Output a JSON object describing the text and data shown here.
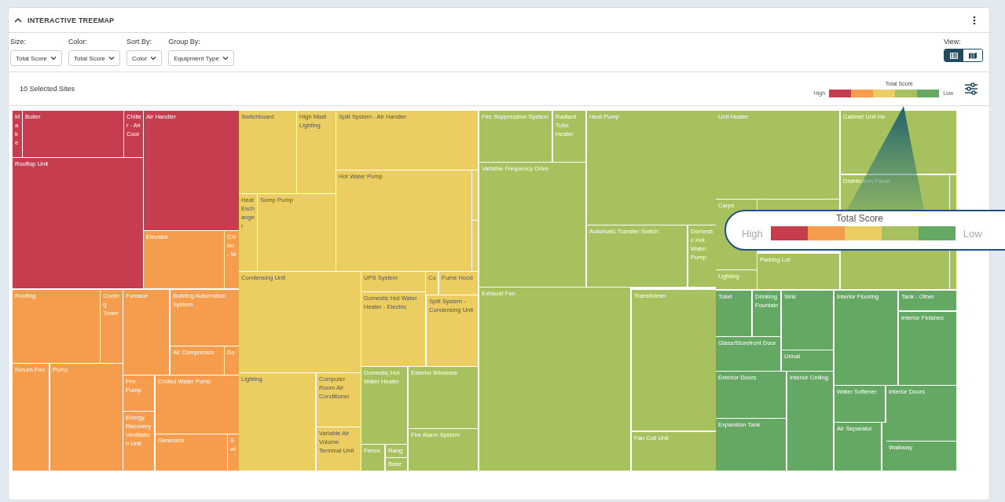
{
  "panel": {
    "title": "INTERACTIVE TREEMAP",
    "expanded": true
  },
  "filters": [
    {
      "label": "Size:",
      "value": "Total Score"
    },
    {
      "label": "Color:",
      "value": "Total Score"
    },
    {
      "label": "Sort By:",
      "value": "Color"
    },
    {
      "label": "Group By:",
      "value": "Equipment Type"
    }
  ],
  "view": {
    "label": "View:",
    "options": [
      {
        "kind": "table",
        "selected": true
      },
      {
        "kind": "map",
        "selected": false
      }
    ]
  },
  "selection_summary": "10 Selected Sites",
  "legend": {
    "title": "Total Score",
    "high": "High",
    "low": "Low",
    "swatches": [
      {
        "color": "#c63d50"
      },
      {
        "color": "#f59d4d"
      },
      {
        "color": "#ebcd62"
      },
      {
        "color": "#a6c15e"
      },
      {
        "color": "#64a864"
      }
    ]
  },
  "treemap": {
    "tiles": [
      {
        "label": "Make",
        "color": "#c63d50"
      },
      {
        "label": "Boiler",
        "color": "#c63d50"
      },
      {
        "label": "Chiller - Air Cool",
        "color": "#c63d50"
      },
      {
        "label": "Rooftop Unit",
        "color": "#c63d50"
      },
      {
        "label": "Air Handler",
        "color": "#c63d50"
      },
      {
        "label": "Elevator",
        "color": "#f59d4d"
      },
      {
        "label": "Chiller - W",
        "color": "#f59d4d"
      },
      {
        "label": "Roofing",
        "color": "#f59d4d"
      },
      {
        "label": "Cooling Tower",
        "color": "#f59d4d"
      },
      {
        "label": "Furnace",
        "color": "#f59d4d"
      },
      {
        "label": "Building Automation System",
        "color": "#f59d4d"
      },
      {
        "label": "Air Compressor",
        "color": "#f59d4d"
      },
      {
        "label": "Do",
        "color": "#f59d4d"
      },
      {
        "label": "Return Fan",
        "color": "#f59d4d"
      },
      {
        "label": "Pump",
        "color": "#f59d4d"
      },
      {
        "label": "Fire Pump",
        "color": "#f59d4d"
      },
      {
        "label": "Energy Recovery Ventilation Unit",
        "color": "#f59d4d"
      },
      {
        "label": "Chilled Water Pump",
        "color": "#f59d4d"
      },
      {
        "label": "Generator",
        "color": "#f59d4d"
      },
      {
        "label": "Swi",
        "color": "#f59d4d"
      },
      {
        "label": "Switchboard",
        "color": "#ebcd62"
      },
      {
        "label": "High Mast Lighting",
        "color": "#ebcd62"
      },
      {
        "label": "Split System - Air Handler",
        "color": "#ebcd62"
      },
      {
        "label": "Heat Exchanger",
        "color": "#ebcd62"
      },
      {
        "label": "Sump Pump",
        "color": "#ebcd62"
      },
      {
        "label": "Hot Water Pump",
        "color": "#ebcd62"
      },
      {
        "color": "#ebcd62"
      },
      {
        "color": "#ebcd62"
      },
      {
        "label": "Condensing Unit",
        "color": "#ebcd62"
      },
      {
        "label": "UPS System",
        "color": "#ebcd62"
      },
      {
        "label": "Co",
        "color": "#ebcd62"
      },
      {
        "label": "Fume Hood",
        "color": "#ebcd62"
      },
      {
        "label": "Domestic Hot Water Heater - Electric",
        "color": "#ebcd62"
      },
      {
        "label": "Split System - Condensing Unit",
        "color": "#ebcd62"
      },
      {
        "label": "Lighting",
        "color": "#ebcd62"
      },
      {
        "label": "Computer Room Air Conditioner",
        "color": "#ebcd62"
      },
      {
        "label": "Variable Air Volume Terminal Unit",
        "color": "#ebcd62"
      },
      {
        "label": "Domestic Hot Water Heater",
        "color": "#a6c15e"
      },
      {
        "label": "Exterior Windows",
        "color": "#a6c15e"
      },
      {
        "label": "Fire Alarm System",
        "color": "#a6c15e"
      },
      {
        "label": "Fence",
        "color": "#a6c15e"
      },
      {
        "label": "Rang",
        "color": "#a6c15e"
      },
      {
        "label": "Base",
        "color": "#a6c15e"
      },
      {
        "label": "Fire Suppression System",
        "color": "#a6c15e"
      },
      {
        "label": "Radiant Tube Heater",
        "color": "#a6c15e"
      },
      {
        "label": "Heat Pump",
        "color": "#a6c15e"
      },
      {
        "label": "Variable Frequency Drive",
        "color": "#a6c15e"
      },
      {
        "label": "Automatic Transfer Switch",
        "color": "#a6c15e"
      },
      {
        "label": "Domestic Hot Water Pump",
        "color": "#a6c15e"
      },
      {
        "label": "Exhaust Fan",
        "color": "#a6c15e"
      },
      {
        "label": "Transformer",
        "color": "#a6c15e"
      },
      {
        "label": "Fan Coil Unit",
        "color": "#a6c15e"
      },
      {
        "label": "Unit Heater",
        "color": "#a6c15e"
      },
      {
        "label": "Cabinet Unit He",
        "color": "#a6c15e"
      },
      {
        "label": "Distribution Panel",
        "color": "#a6c15e"
      },
      {
        "color": "#a6c15e"
      },
      {
        "label": "Carpe",
        "color": "#a6c15e"
      },
      {
        "color": "#a6c15e"
      },
      {
        "label": "Parking Lot",
        "color": "#a6c15e"
      },
      {
        "label": "Lighting",
        "color": "#a6c15e"
      },
      {
        "label": "Toilet",
        "color": "#64a864"
      },
      {
        "label": "Drinking Fountain",
        "color": "#64a864"
      },
      {
        "label": "Sink",
        "color": "#64a864"
      },
      {
        "label": "Glass/Storefront Door",
        "color": "#64a864"
      },
      {
        "label": "Urinal",
        "color": "#64a864"
      },
      {
        "label": "Interior Flooring",
        "color": "#64a864"
      },
      {
        "label": "Tank - Other",
        "color": "#64a864"
      },
      {
        "label": "Interior Finishes",
        "color": "#64a864"
      },
      {
        "label": "Exterior Doors",
        "color": "#64a864"
      },
      {
        "label": "Interior Ceiling",
        "color": "#64a864"
      },
      {
        "label": "Water Softener",
        "color": "#64a864"
      },
      {
        "label": "Interior Doors",
        "color": "#64a864"
      },
      {
        "label": "Expansion Tank",
        "color": "#64a864"
      },
      {
        "label": "Air Separator",
        "color": "#64a864"
      },
      {
        "color": "#64a864"
      },
      {
        "label": "Walkway",
        "color": "#64a864"
      }
    ]
  },
  "callout": {
    "title": "Total Score",
    "high": "High",
    "low": "Low",
    "swatches": [
      {
        "color": "#c63d50"
      },
      {
        "color": "#f59d4d"
      },
      {
        "color": "#ebcd62"
      },
      {
        "color": "#a6c15e"
      },
      {
        "color": "#64a864"
      }
    ]
  }
}
